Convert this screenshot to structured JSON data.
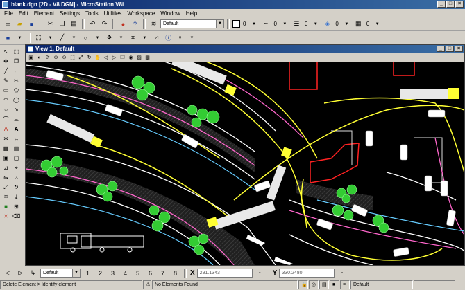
{
  "window": {
    "title": "blank.dgn [2D - V8 DGN] - MicroStation V8i"
  },
  "menu": [
    "File",
    "Edit",
    "Element",
    "Settings",
    "Tools",
    "Utilities",
    "Workspace",
    "Window",
    "Help"
  ],
  "toolbar2": {
    "level": "Default",
    "color_num": "0",
    "style_num": "0",
    "weight_num": "0",
    "trans_num": "0",
    "prio_num": "0"
  },
  "view": {
    "title": "View 1, Default"
  },
  "coords": {
    "model": "Default",
    "x_label": "X",
    "x_value": "291.1343",
    "y_label": "Y",
    "y_value": "330.2480"
  },
  "status": {
    "left": "Delete Element > Identify element",
    "middle": "No Elements Found",
    "right": "Default"
  },
  "colors": {
    "road_white": "#ffffff",
    "road_pink": "#ff66cc",
    "road_yellow": "#ffff33",
    "road_cyan": "#66ccff",
    "tree_green": "#33cc33",
    "outline_red": "#ff2222"
  }
}
